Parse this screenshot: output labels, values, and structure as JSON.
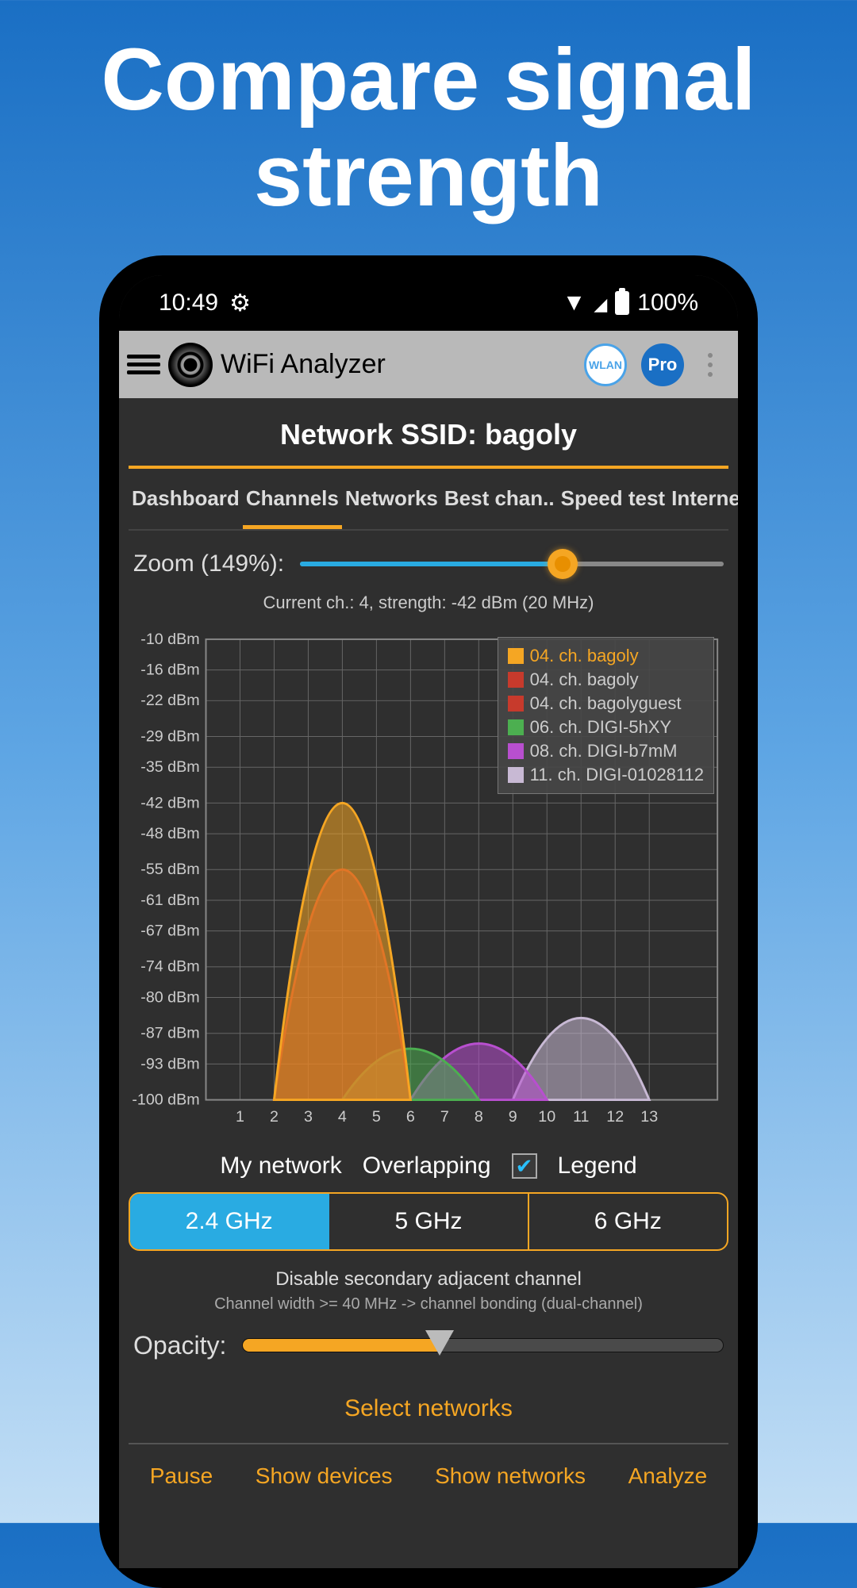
{
  "hero": {
    "line1": "Compare signal",
    "line2": "strength"
  },
  "status": {
    "time": "10:49",
    "battery": "100%"
  },
  "appbar": {
    "title": "WiFi Analyzer",
    "wlan": "WLAN",
    "pro": "Pro"
  },
  "network": {
    "label": "Network SSID: bagoly"
  },
  "tabs": [
    "Dashboard",
    "Channels",
    "Networks",
    "Best chan..",
    "Speed test",
    "Internet"
  ],
  "tabs_active": 1,
  "zoom": {
    "label": "Zoom (149%):",
    "percent": 62
  },
  "chart_caption": "Current ch.: 4, strength: -42 dBm (20 MHz)",
  "chart_data": {
    "type": "area",
    "xlabel": "",
    "ylabel": "",
    "y_ticks": [
      -10,
      -16,
      -22,
      -29,
      -35,
      -42,
      -48,
      -55,
      -61,
      -67,
      -74,
      -80,
      -87,
      -93,
      -100
    ],
    "x_ticks": [
      1,
      2,
      3,
      4,
      5,
      6,
      7,
      8,
      9,
      10,
      11,
      12,
      13
    ],
    "ylim": [
      -100,
      -10
    ],
    "xlim": [
      0,
      15
    ],
    "series": [
      {
        "name": "04. ch. bagoly",
        "color": "#f5a623",
        "center": 4,
        "peak_dbm": -42,
        "half_width": 2.0
      },
      {
        "name": "04. ch. bagoly",
        "color": "#c73a2c",
        "center": 4,
        "peak_dbm": -55,
        "half_width": 2.0
      },
      {
        "name": "04. ch. bagolyguest",
        "color": "#c73a2c",
        "center": 4,
        "peak_dbm": -55,
        "half_width": 2.0
      },
      {
        "name": "06. ch. DIGI-5hXY",
        "color": "#4caf50",
        "center": 6,
        "peak_dbm": -90,
        "half_width": 2.0
      },
      {
        "name": "08. ch. DIGI-b7mM",
        "color": "#b84fcf",
        "center": 8,
        "peak_dbm": -89,
        "half_width": 2.0
      },
      {
        "name": "11. ch. DIGI-01028112",
        "color": "#c8b9d4",
        "center": 11,
        "peak_dbm": -84,
        "half_width": 2.0
      }
    ],
    "legend_highlight_index": 0
  },
  "toggles": {
    "my_network": "My network",
    "overlapping": "Overlapping",
    "legend": "Legend",
    "legend_checked": true
  },
  "bands": {
    "items": [
      "2.4 GHz",
      "5 GHz",
      "6 GHz"
    ],
    "active": 0
  },
  "hints": {
    "line1": "Disable secondary adjacent channel",
    "line2": "Channel width >= 40 MHz -> channel bonding (dual-channel)"
  },
  "opacity": {
    "label": "Opacity:",
    "percent": 41
  },
  "select_networks": "Select networks",
  "bottom": [
    "Pause",
    "Show devices",
    "Show networks",
    "Analyze"
  ]
}
